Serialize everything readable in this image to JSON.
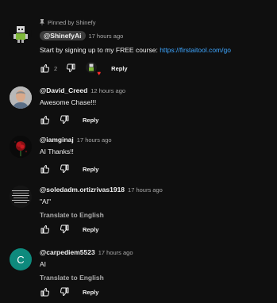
{
  "comments": [
    {
      "pinned_label": "Pinned by Shinefy",
      "author": "@ShinefyAi",
      "time": "17 hours ago",
      "text_prefix": "Start by signing up to my FREE course: ",
      "link": "https://firstaitool.com/go",
      "likes": "2",
      "reply_label": "Reply",
      "avatar_kind": "robot"
    },
    {
      "author": "@David_Creed",
      "time": "12 hours ago",
      "text": "Awesome Chase!!!",
      "reply_label": "Reply",
      "avatar_kind": "photo-man"
    },
    {
      "author": "@iamginaj",
      "time": "17 hours ago",
      "text": "AI Thanks!!",
      "reply_label": "Reply",
      "avatar_kind": "rose"
    },
    {
      "author": "@soledadm.ortizrivas1918",
      "time": "17 hours ago",
      "text": "\"AI\"",
      "translate_label": "Translate to English",
      "reply_label": "Reply",
      "avatar_kind": "text-image"
    },
    {
      "author": "@carpediem5523",
      "time": "17 hours ago",
      "text": "AI",
      "translate_label": "Translate to English",
      "reply_label": "Reply",
      "avatar_letter": "C",
      "avatar_color": "#0e8a7d"
    }
  ],
  "colors": {
    "background": "#0f0f0f",
    "link": "#3ea6ff",
    "muted": "#aaaaaa"
  }
}
